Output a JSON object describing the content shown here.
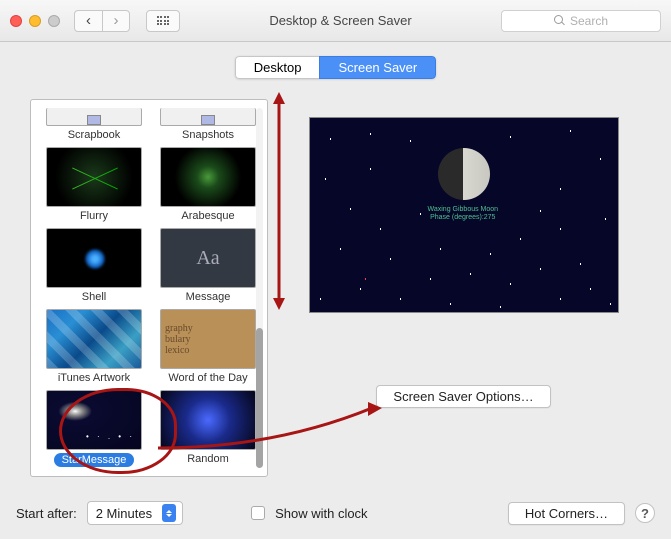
{
  "window": {
    "title": "Desktop & Screen Saver",
    "search_placeholder": "Search"
  },
  "tabs": {
    "desktop": "Desktop",
    "screensaver": "Screen Saver",
    "active": "screensaver"
  },
  "savers": [
    {
      "label": "Scrapbook",
      "kind": "partial"
    },
    {
      "label": "Snapshots",
      "kind": "partial"
    },
    {
      "label": "Flurry",
      "kind": "flurry"
    },
    {
      "label": "Arabesque",
      "kind": "arabesque"
    },
    {
      "label": "Shell",
      "kind": "shell"
    },
    {
      "label": "Message",
      "kind": "msg",
      "txt": "Aa"
    },
    {
      "label": "iTunes Artwork",
      "kind": "itunes"
    },
    {
      "label": "Word of the Day",
      "kind": "wotd",
      "l1": "graphy",
      "l2": "bulary",
      "l3": "lexico"
    },
    {
      "label": "StarMessage",
      "kind": "starm",
      "selected": true,
      "circled": true
    },
    {
      "label": "Random",
      "kind": "rand"
    }
  ],
  "preview": {
    "line1": "Waxing Gibbous Moon",
    "line2": "Phase (degrees):275"
  },
  "options_button": "Screen Saver Options…",
  "bottom": {
    "start_after_label": "Start after:",
    "start_after_value": "2 Minutes",
    "show_clock_label": "Show with clock",
    "hot_corners": "Hot Corners…"
  },
  "annotations": {
    "circle_arrow_target": "Screen Saver Options…",
    "vertical_arrow": "scroll-down"
  }
}
